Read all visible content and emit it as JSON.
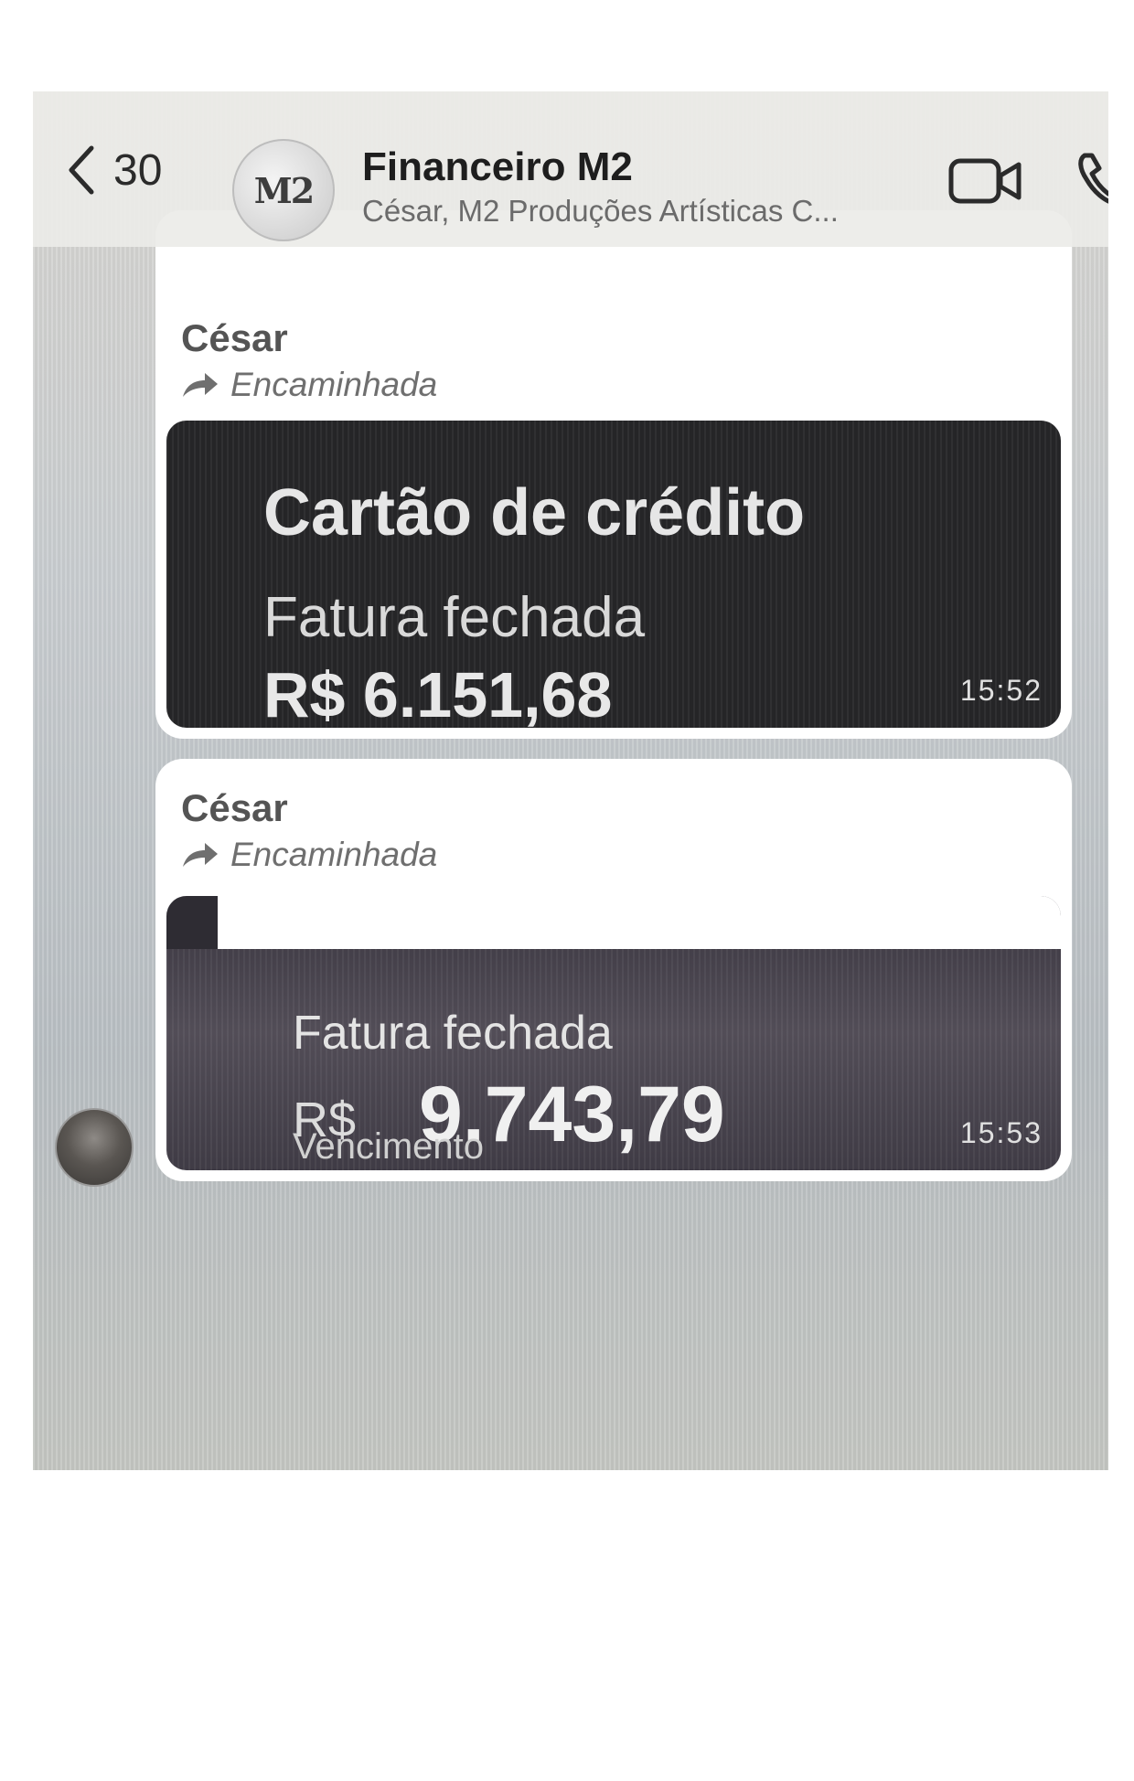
{
  "header": {
    "back_count": "30",
    "group_avatar_text": "M2",
    "title": "Financeiro M2",
    "subtitle": "César, M2 Produções Artísticas C..."
  },
  "messages": [
    {
      "sender": "César",
      "forwarded_label": "Encaminhada",
      "card_title": "Cartão de crédito",
      "card_label": "Fatura fechada",
      "card_amount": "R$ 6.151,68",
      "time": "15:52"
    },
    {
      "sender": "César",
      "forwarded_label": "Encaminhada",
      "card_label": "Fatura fechada",
      "card_currency": "R$",
      "card_amount": "9.743,79",
      "card_due_label": "Vencimento",
      "time": "15:53"
    }
  ],
  "icons": {
    "back": "chevron-left-icon",
    "video": "video-camera-icon",
    "phone": "phone-icon",
    "forward": "forward-arrow-icon"
  },
  "colors": {
    "header_bg": "#ecece8",
    "bubble_bg": "#ffffff",
    "card_bg": "#252527",
    "card2_bg": "#3f3b45"
  }
}
